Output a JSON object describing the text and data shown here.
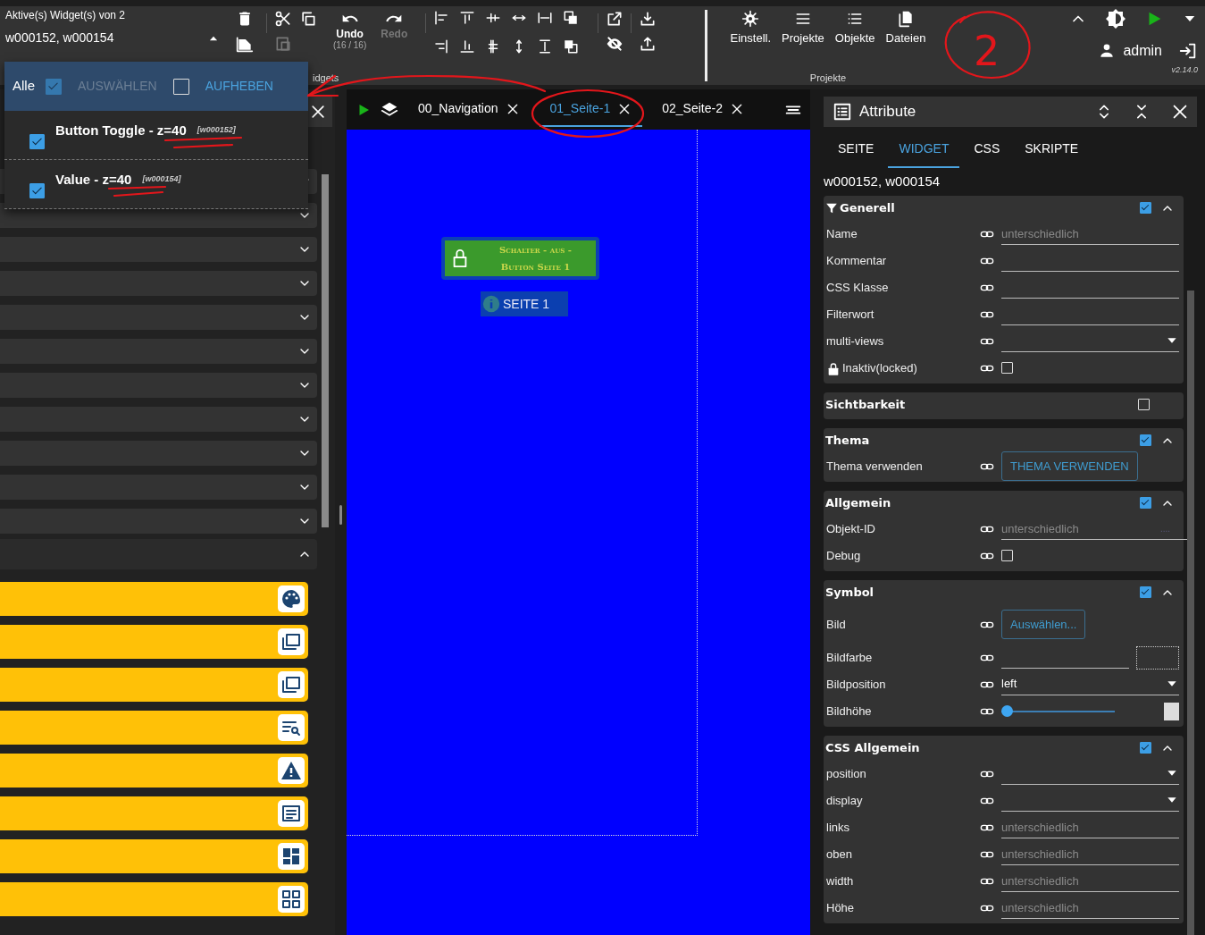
{
  "toolbar": {
    "active_label": "Aktive(s) Widget(s) von 2",
    "selected_widgets": "w000152, w000154",
    "paste": {
      "disabled": true
    },
    "undo": {
      "label": "Undo",
      "count": "(16 / 16)",
      "disabled": false
    },
    "redo": {
      "label": "Redo",
      "disabled": true
    },
    "widgets_group_label": "idgets",
    "project_buttons": [
      {
        "label": "Einstell."
      },
      {
        "label": "Projekte"
      },
      {
        "label": "Objekte"
      },
      {
        "label": "Dateien"
      }
    ],
    "projects_group_label": "Projekte",
    "user": "admin",
    "version": "v2.14.0"
  },
  "widget_menu": {
    "all_label": "Alle",
    "select_all": {
      "label": "AUSWÄHLEN",
      "checked": true,
      "disabled": true
    },
    "deselect": {
      "label": "AUFHEBEN",
      "checked": false,
      "disabled": false
    },
    "items": [
      {
        "name": "Button Toggle - z=40",
        "ref": "[w000152]",
        "checked": true
      },
      {
        "name": "Value - z=40",
        "ref": "[w000154]",
        "checked": true
      }
    ]
  },
  "left_panel": {
    "sections": [
      {
        "expanded": false
      },
      {
        "expanded": false
      },
      {
        "expanded": false
      },
      {
        "expanded": false
      },
      {
        "expanded": false
      },
      {
        "expanded": false
      },
      {
        "expanded": false
      },
      {
        "expanded": false
      },
      {
        "expanded": false
      },
      {
        "expanded": false
      },
      {
        "expanded": false
      },
      {
        "expanded": true
      }
    ]
  },
  "tabs": [
    {
      "label": "00_Navigation",
      "selected": false
    },
    {
      "label": "01_Seite-1",
      "selected": true
    },
    {
      "label": "02_Seite-2",
      "selected": false
    }
  ],
  "canvas": {
    "button_widget": {
      "lines": [
        "Schalter - aus -",
        "Button Seite 1"
      ]
    },
    "info_widget": {
      "text": "SEITE 1"
    }
  },
  "attributes": {
    "title": "Attribute",
    "tabs": [
      {
        "label": "SEITE",
        "selected": false
      },
      {
        "label": "WIDGET",
        "selected": true
      },
      {
        "label": "CSS",
        "selected": false
      },
      {
        "label": "SKRIPTE",
        "selected": false
      }
    ],
    "widget_ids": "w000152, w000154",
    "sections": [
      {
        "title": "Generell",
        "filter": true,
        "enabled": true,
        "expanded": true,
        "rows": [
          {
            "kind": "text",
            "label": "Name",
            "placeholder": "unterschiedlich"
          },
          {
            "kind": "text",
            "label": "Kommentar"
          },
          {
            "kind": "text",
            "label": "CSS Klasse"
          },
          {
            "kind": "text",
            "label": "Filterwort"
          },
          {
            "kind": "select",
            "label": "multi-views"
          },
          {
            "kind": "checkbox",
            "label": "Inaktiv(locked)",
            "lock": true,
            "checked": false
          }
        ]
      },
      {
        "title": "Sichtbarkeit",
        "enabled": false
      },
      {
        "title": "Thema",
        "enabled": true,
        "expanded": true,
        "rows": [
          {
            "kind": "button",
            "label": "Thema verwenden",
            "button": "THEMA VERWENDEN"
          }
        ]
      },
      {
        "title": "Allgemein",
        "enabled": true,
        "expanded": true,
        "rows": [
          {
            "kind": "text",
            "label": "Objekt-ID",
            "placeholder": "unterschiedlich",
            "suffix": "...."
          },
          {
            "kind": "checkbox",
            "label": "Debug",
            "checked": false
          }
        ]
      },
      {
        "title": "Symbol",
        "enabled": true,
        "expanded": true,
        "rows": [
          {
            "kind": "button",
            "label": "Bild",
            "button": "Auswählen..."
          },
          {
            "kind": "color",
            "label": "Bildfarbe"
          },
          {
            "kind": "select",
            "label": "Bildposition",
            "value": "left"
          },
          {
            "kind": "slider",
            "label": "Bildhöhe",
            "level": 0
          }
        ]
      },
      {
        "title": "CSS Allgemein",
        "enabled": true,
        "expanded": true,
        "rows": [
          {
            "kind": "select",
            "label": "position"
          },
          {
            "kind": "select",
            "label": "display"
          },
          {
            "kind": "text",
            "label": "links",
            "placeholder": "unterschiedlich"
          },
          {
            "kind": "text",
            "label": "oben",
            "placeholder": "unterschiedlich"
          },
          {
            "kind": "text",
            "label": "width",
            "placeholder": "unterschiedlich"
          },
          {
            "kind": "text",
            "label": "Höhe",
            "placeholder": "unterschiedlich"
          }
        ]
      }
    ]
  },
  "annotation": {
    "mark": "2"
  }
}
